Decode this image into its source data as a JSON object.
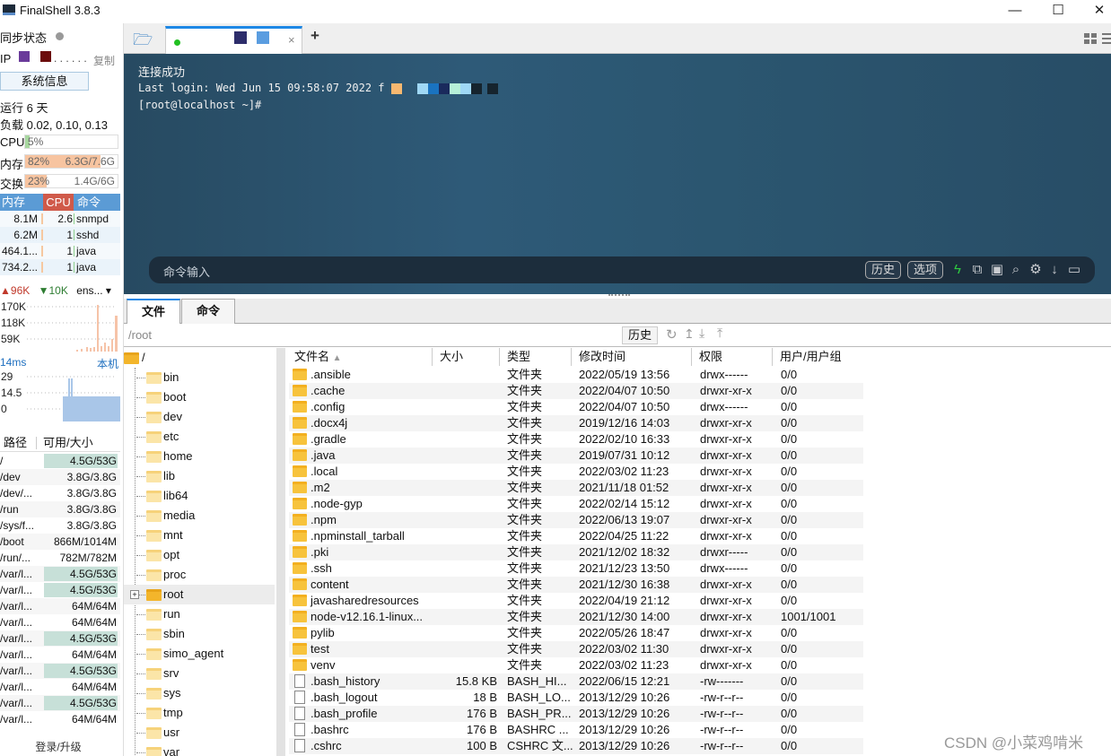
{
  "app": {
    "title": "FinalShell 3.8.3"
  },
  "window_controls": {
    "minimize": "—",
    "maximize": "☐",
    "close": "✕"
  },
  "sidebar": {
    "sync_label": "同步状态",
    "ip_label": "IP",
    "copy_label": "复制",
    "sysinfo_button": "系统信息",
    "uptime": "运行 6 天",
    "load": "负载 0.02, 0.10, 0.13",
    "cpu": {
      "label": "CPU",
      "percent": 5,
      "text": "5%"
    },
    "mem": {
      "label": "内存",
      "percent": 82,
      "text": "82%",
      "detail": "6.3G/7.6G"
    },
    "swap": {
      "label": "交换",
      "percent": 23,
      "text": "23%",
      "detail": "1.4G/6G"
    },
    "proc_headers": [
      "内存",
      "CPU",
      "命令"
    ],
    "processes": [
      {
        "mem": "8.1M",
        "cpu": "2.6",
        "cmd": "snmpd"
      },
      {
        "mem": "6.2M",
        "cpu": "1",
        "cmd": "sshd"
      },
      {
        "mem": "464.1...",
        "cpu": "1",
        "cmd": "java"
      },
      {
        "mem": "734.2...",
        "cpu": "1",
        "cmd": "java"
      }
    ],
    "net": {
      "up": "96K",
      "down": "10K",
      "iface": "ens...",
      "ticks": [
        "170K",
        "118K",
        "59K"
      ]
    },
    "ping": {
      "latency": "14ms",
      "host": "本机",
      "ticks": [
        "29",
        "14.5",
        "0"
      ]
    },
    "disk_headers": [
      "路径",
      "可用/大小"
    ],
    "disks": [
      {
        "path": "/",
        "usage": "4.5G/53G",
        "highlight": true
      },
      {
        "path": "/dev",
        "usage": "3.8G/3.8G",
        "highlight": false
      },
      {
        "path": "/dev/...",
        "usage": "3.8G/3.8G",
        "highlight": false
      },
      {
        "path": "/run",
        "usage": "3.8G/3.8G",
        "highlight": false
      },
      {
        "path": "/sys/f...",
        "usage": "3.8G/3.8G",
        "highlight": false
      },
      {
        "path": "/boot",
        "usage": "866M/1014M",
        "highlight": false
      },
      {
        "path": "/run/...",
        "usage": "782M/782M",
        "highlight": false
      },
      {
        "path": "/var/l...",
        "usage": "4.5G/53G",
        "highlight": true
      },
      {
        "path": "/var/l...",
        "usage": "4.5G/53G",
        "highlight": true
      },
      {
        "path": "/var/l...",
        "usage": "64M/64M",
        "highlight": false
      },
      {
        "path": "/var/l...",
        "usage": "64M/64M",
        "highlight": false
      },
      {
        "path": "/var/l...",
        "usage": "4.5G/53G",
        "highlight": true
      },
      {
        "path": "/var/l...",
        "usage": "64M/64M",
        "highlight": false
      },
      {
        "path": "/var/l...",
        "usage": "4.5G/53G",
        "highlight": true
      },
      {
        "path": "/var/l...",
        "usage": "64M/64M",
        "highlight": false
      },
      {
        "path": "/var/l...",
        "usage": "4.5G/53G",
        "highlight": true
      },
      {
        "path": "/var/l...",
        "usage": "64M/64M",
        "highlight": false
      }
    ],
    "login_label": "登录/升级"
  },
  "tabs": {
    "add": "+",
    "close": "×"
  },
  "terminal": {
    "lines": [
      "连接成功",
      "Last login: Wed Jun 15 09:58:07 2022 f",
      "[root@localhost ~]#"
    ],
    "cmd_placeholder": "命令输入",
    "history_button": "历史",
    "options_button": "选项"
  },
  "filepanel": {
    "tabs": [
      "文件",
      "命令"
    ],
    "path": "/root",
    "history_button": "历史",
    "tree_root": "/",
    "tree": [
      "bin",
      "boot",
      "dev",
      "etc",
      "home",
      "lib",
      "lib64",
      "media",
      "mnt",
      "opt",
      "proc",
      "root",
      "run",
      "sbin",
      "simo_agent",
      "srv",
      "sys",
      "tmp",
      "usr",
      "var"
    ],
    "selected_tree": "root",
    "columns": [
      "文件名",
      "大小",
      "类型",
      "修改时间",
      "权限",
      "用户/用户组"
    ],
    "files": [
      {
        "name": ".ansible",
        "size": "",
        "type": "文件夹",
        "mtime": "2022/05/19 13:56",
        "perm": "drwx------",
        "owner": "0/0",
        "dir": true
      },
      {
        "name": ".cache",
        "size": "",
        "type": "文件夹",
        "mtime": "2022/04/07 10:50",
        "perm": "drwxr-xr-x",
        "owner": "0/0",
        "dir": true
      },
      {
        "name": ".config",
        "size": "",
        "type": "文件夹",
        "mtime": "2022/04/07 10:50",
        "perm": "drwx------",
        "owner": "0/0",
        "dir": true
      },
      {
        "name": ".docx4j",
        "size": "",
        "type": "文件夹",
        "mtime": "2019/12/16 14:03",
        "perm": "drwxr-xr-x",
        "owner": "0/0",
        "dir": true
      },
      {
        "name": ".gradle",
        "size": "",
        "type": "文件夹",
        "mtime": "2022/02/10 16:33",
        "perm": "drwxr-xr-x",
        "owner": "0/0",
        "dir": true
      },
      {
        "name": ".java",
        "size": "",
        "type": "文件夹",
        "mtime": "2019/07/31 10:12",
        "perm": "drwxr-xr-x",
        "owner": "0/0",
        "dir": true
      },
      {
        "name": ".local",
        "size": "",
        "type": "文件夹",
        "mtime": "2022/03/02 11:23",
        "perm": "drwxr-xr-x",
        "owner": "0/0",
        "dir": true
      },
      {
        "name": ".m2",
        "size": "",
        "type": "文件夹",
        "mtime": "2021/11/18 01:52",
        "perm": "drwxr-xr-x",
        "owner": "0/0",
        "dir": true
      },
      {
        "name": ".node-gyp",
        "size": "",
        "type": "文件夹",
        "mtime": "2022/02/14 15:12",
        "perm": "drwxr-xr-x",
        "owner": "0/0",
        "dir": true
      },
      {
        "name": ".npm",
        "size": "",
        "type": "文件夹",
        "mtime": "2022/06/13 19:07",
        "perm": "drwxr-xr-x",
        "owner": "0/0",
        "dir": true
      },
      {
        "name": ".npminstall_tarball",
        "size": "",
        "type": "文件夹",
        "mtime": "2022/04/25 11:22",
        "perm": "drwxr-xr-x",
        "owner": "0/0",
        "dir": true
      },
      {
        "name": ".pki",
        "size": "",
        "type": "文件夹",
        "mtime": "2021/12/02 18:32",
        "perm": "drwxr-----",
        "owner": "0/0",
        "dir": true
      },
      {
        "name": ".ssh",
        "size": "",
        "type": "文件夹",
        "mtime": "2021/12/23 13:50",
        "perm": "drwx------",
        "owner": "0/0",
        "dir": true
      },
      {
        "name": "content",
        "size": "",
        "type": "文件夹",
        "mtime": "2021/12/30 16:38",
        "perm": "drwxr-xr-x",
        "owner": "0/0",
        "dir": true
      },
      {
        "name": "javasharedresources",
        "size": "",
        "type": "文件夹",
        "mtime": "2022/04/19 21:12",
        "perm": "drwxr-xr-x",
        "owner": "0/0",
        "dir": true
      },
      {
        "name": "node-v12.16.1-linux...",
        "size": "",
        "type": "文件夹",
        "mtime": "2021/12/30 14:00",
        "perm": "drwxr-xr-x",
        "owner": "1001/1001",
        "dir": true
      },
      {
        "name": "pylib",
        "size": "",
        "type": "文件夹",
        "mtime": "2022/05/26 18:47",
        "perm": "drwxr-xr-x",
        "owner": "0/0",
        "dir": true
      },
      {
        "name": "test",
        "size": "",
        "type": "文件夹",
        "mtime": "2022/03/02 11:30",
        "perm": "drwxr-xr-x",
        "owner": "0/0",
        "dir": true
      },
      {
        "name": "venv",
        "size": "",
        "type": "文件夹",
        "mtime": "2022/03/02 11:23",
        "perm": "drwxr-xr-x",
        "owner": "0/0",
        "dir": true
      },
      {
        "name": ".bash_history",
        "size": "15.8 KB",
        "type": "BASH_HI...",
        "mtime": "2022/06/15 12:21",
        "perm": "-rw-------",
        "owner": "0/0",
        "dir": false
      },
      {
        "name": ".bash_logout",
        "size": "18 B",
        "type": "BASH_LO...",
        "mtime": "2013/12/29 10:26",
        "perm": "-rw-r--r--",
        "owner": "0/0",
        "dir": false
      },
      {
        "name": ".bash_profile",
        "size": "176 B",
        "type": "BASH_PR...",
        "mtime": "2013/12/29 10:26",
        "perm": "-rw-r--r--",
        "owner": "0/0",
        "dir": false
      },
      {
        "name": ".bashrc",
        "size": "176 B",
        "type": "BASHRC ...",
        "mtime": "2013/12/29 10:26",
        "perm": "-rw-r--r--",
        "owner": "0/0",
        "dir": false
      },
      {
        "name": ".cshrc",
        "size": "100 B",
        "type": "CSHRC 文...",
        "mtime": "2013/12/29 10:26",
        "perm": "-rw-r--r--",
        "owner": "0/0",
        "dir": false
      }
    ]
  },
  "watermark": "CSDN @小菜鸡啃米",
  "colors": {
    "cpu_fill": "#a8d8a0",
    "mem_fill": "#f7c4a0",
    "proc_mem_head": "#5b9bd5",
    "proc_cpu_head": "#d05a4a",
    "disk_highlight": "#c7e0d8",
    "terminal_bg": "#2b5670",
    "accent": "#1e90ff"
  }
}
